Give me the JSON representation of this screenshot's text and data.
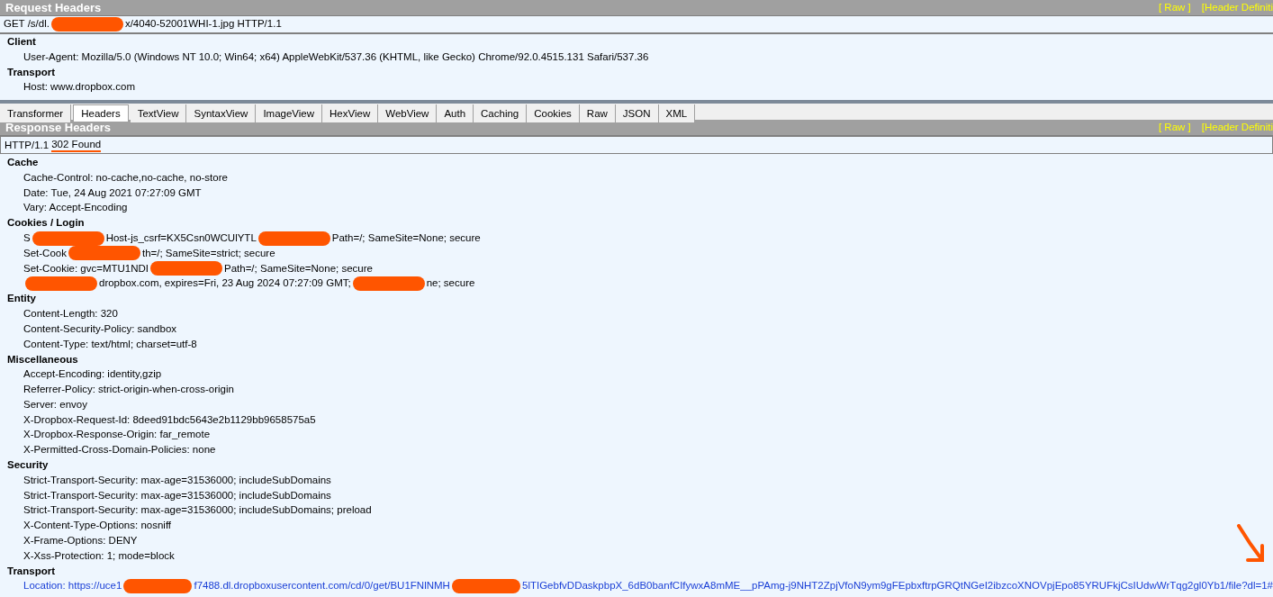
{
  "request": {
    "title": "Request Headers",
    "links": [
      "[ Raw ]",
      "[Header Definiti"
    ],
    "first_line": [
      {
        "kind": "text",
        "text": "GET /s/dl."
      },
      {
        "kind": "redaction"
      },
      {
        "kind": "text",
        "text": "x/4040-52001WHI-1.jpg HTTP/1.1"
      }
    ],
    "groups": [
      {
        "name": "Client",
        "lines": [
          [
            {
              "kind": "text",
              "text": "User-Agent: Mozilla/5.0 (Windows NT 10.0; Win64; x64) AppleWebKit/537.36 (KHTML, like Gecko) Chrome/92.0.4515.131 Safari/537.36"
            }
          ]
        ]
      },
      {
        "name": "Transport",
        "lines": [
          [
            {
              "kind": "text",
              "text": "Host: www.dropbox.com"
            }
          ]
        ]
      }
    ]
  },
  "tabs": [
    {
      "label": "Transformer",
      "selected": false
    },
    {
      "label": "Headers",
      "selected": true
    },
    {
      "label": "TextView",
      "selected": false
    },
    {
      "label": "SyntaxView",
      "selected": false
    },
    {
      "label": "ImageView",
      "selected": false
    },
    {
      "label": "HexView",
      "selected": false
    },
    {
      "label": "WebView",
      "selected": false
    },
    {
      "label": "Auth",
      "selected": false
    },
    {
      "label": "Caching",
      "selected": false
    },
    {
      "label": "Cookies",
      "selected": false
    },
    {
      "label": "Raw",
      "selected": false
    },
    {
      "label": "JSON",
      "selected": false
    },
    {
      "label": "XML",
      "selected": false
    }
  ],
  "response": {
    "title": "Response Headers",
    "links": [
      "[ Raw ]",
      "[Header Definiti"
    ],
    "status": {
      "version": "HTTP/1.1",
      "code": "302 Found",
      "underlined": true
    },
    "groups": [
      {
        "name": "Cache",
        "lines": [
          [
            {
              "kind": "text",
              "text": "Cache-Control: no-cache,no-cache, no-store"
            }
          ],
          [
            {
              "kind": "text",
              "text": "Date: Tue, 24 Aug 2021 07:27:09 GMT"
            }
          ],
          [
            {
              "kind": "text",
              "text": "Vary: Accept-Encoding"
            }
          ]
        ]
      },
      {
        "name": "Cookies / Login",
        "lines": [
          [
            {
              "kind": "text",
              "text": "S"
            },
            {
              "kind": "redaction"
            },
            {
              "kind": "text",
              "text": "Host-js_csrf=KX5Csn0WCUlYTL"
            },
            {
              "kind": "redaction"
            },
            {
              "kind": "text",
              "text": "Path=/; SameSite=None; secure"
            }
          ],
          [
            {
              "kind": "text",
              "text": "Set-Cook"
            },
            {
              "kind": "redaction"
            },
            {
              "kind": "text",
              "text": "th=/; SameSite=strict; secure"
            }
          ],
          [
            {
              "kind": "text",
              "text": "Set-Cookie: gvc=MTU1NDI"
            },
            {
              "kind": "redaction"
            },
            {
              "kind": "text",
              "text": "Path=/; SameSite=None; secure"
            }
          ],
          [
            {
              "kind": "redaction"
            },
            {
              "kind": "text",
              "text": "dropbox.com, expires=Fri, 23 Aug 2024 07:27:09 GMT;"
            },
            {
              "kind": "redaction"
            },
            {
              "kind": "text",
              "text": "ne; secure"
            }
          ]
        ]
      },
      {
        "name": "Entity",
        "lines": [
          [
            {
              "kind": "text",
              "text": "Content-Length: 320"
            }
          ],
          [
            {
              "kind": "text",
              "text": "Content-Security-Policy: sandbox"
            }
          ],
          [
            {
              "kind": "text",
              "text": "Content-Type: text/html; charset=utf-8"
            }
          ]
        ]
      },
      {
        "name": "Miscellaneous",
        "lines": [
          [
            {
              "kind": "text",
              "text": "Accept-Encoding: identity,gzip"
            }
          ],
          [
            {
              "kind": "text",
              "text": "Referrer-Policy: strict-origin-when-cross-origin"
            }
          ],
          [
            {
              "kind": "text",
              "text": "Server: envoy"
            }
          ],
          [
            {
              "kind": "text",
              "text": "X-Dropbox-Request-Id: 8deed91bdc5643e2b1129bb9658575a5"
            }
          ],
          [
            {
              "kind": "text",
              "text": "X-Dropbox-Response-Origin: far_remote"
            }
          ],
          [
            {
              "kind": "text",
              "text": "X-Permitted-Cross-Domain-Policies: none"
            }
          ]
        ]
      },
      {
        "name": "Security",
        "lines": [
          [
            {
              "kind": "text",
              "text": "Strict-Transport-Security: max-age=31536000; includeSubDomains"
            }
          ],
          [
            {
              "kind": "text",
              "text": "Strict-Transport-Security: max-age=31536000; includeSubDomains"
            }
          ],
          [
            {
              "kind": "text",
              "text": "Strict-Transport-Security: max-age=31536000; includeSubDomains; preload"
            }
          ],
          [
            {
              "kind": "text",
              "text": "X-Content-Type-Options: nosniff"
            }
          ],
          [
            {
              "kind": "text",
              "text": "X-Frame-Options: DENY"
            }
          ],
          [
            {
              "kind": "text",
              "text": "X-Xss-Protection: 1; mode=block"
            }
          ]
        ]
      },
      {
        "name": "Transport",
        "lines": [
          [
            {
              "kind": "link",
              "text": "Location: https://uce1"
            },
            {
              "kind": "redaction"
            },
            {
              "kind": "link",
              "text": "f7488.dl.dropboxusercontent.com/cd/0/get/BU1FNlNMH"
            },
            {
              "kind": "redaction"
            },
            {
              "kind": "link",
              "text": "5lTIGebfvDDaskpbpX_6dB0banfCIfywxA8mME__pPAmg-j9NHT2ZpjVfoN9ym9gFEpbxftrpGRQtNGeI2ibzcoXNOVpjEpo85YRUFkjCsIUdwWrTqg2gl0Yb1/file?dl=1#"
            }
          ]
        ]
      }
    ],
    "arrow_annotation": true
  }
}
